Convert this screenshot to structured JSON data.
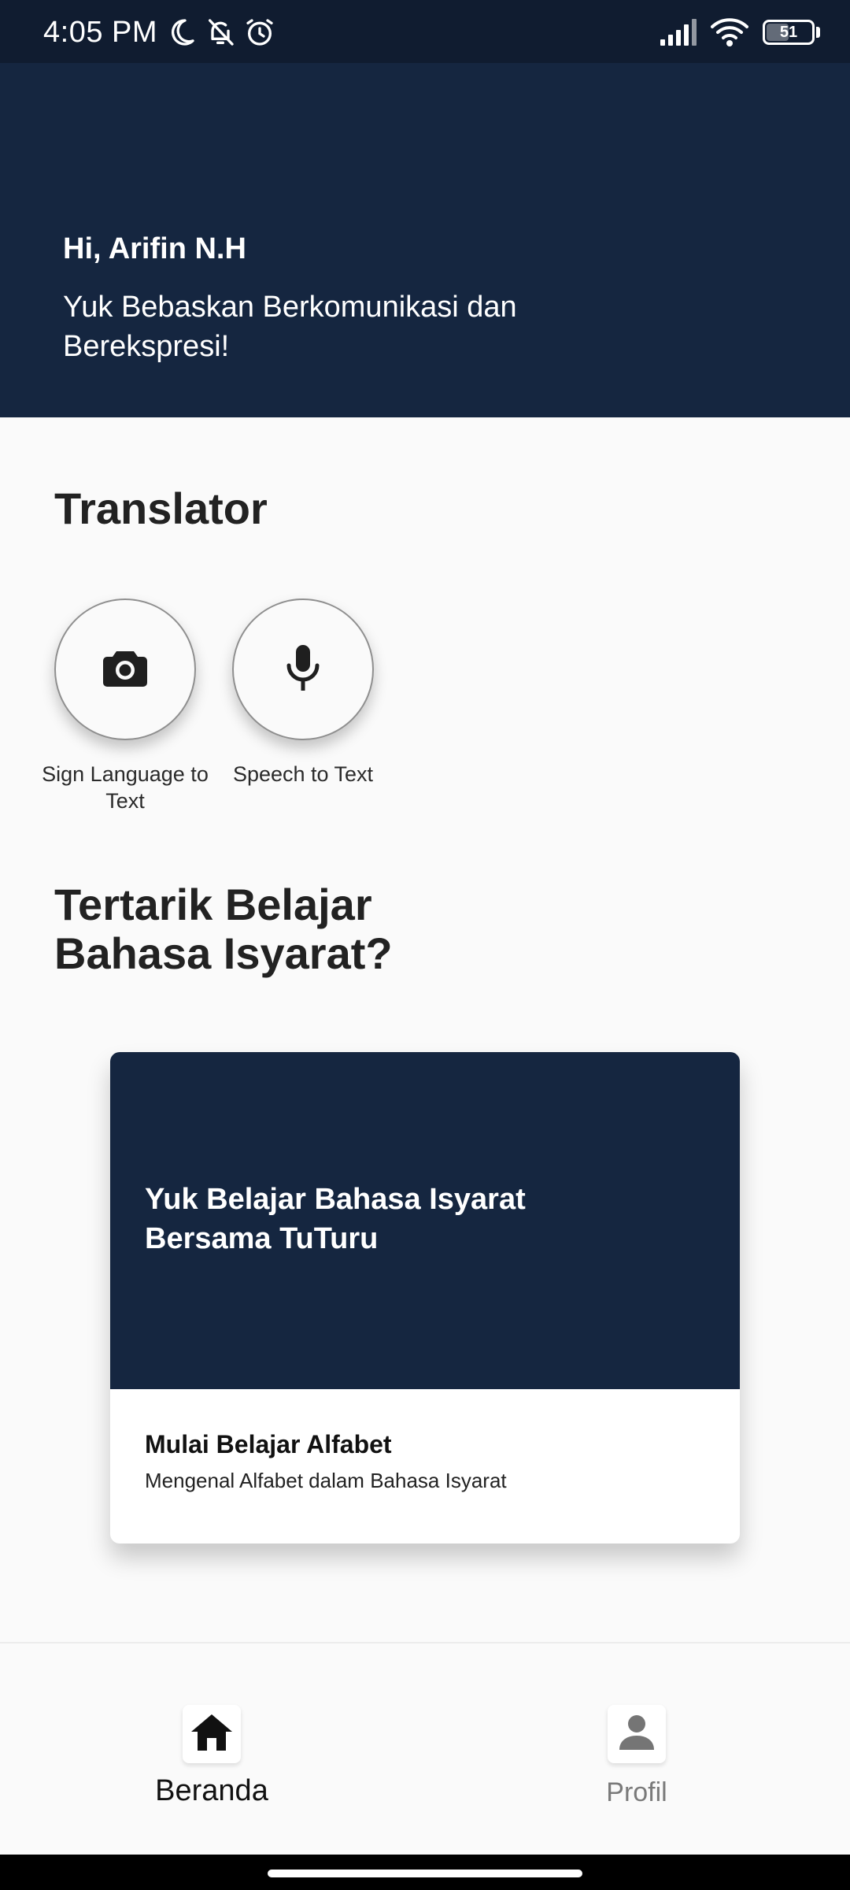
{
  "status_bar": {
    "time": "4:05 PM",
    "battery_level": "51",
    "icons": [
      "moon-icon",
      "bell-off-icon",
      "alarm-icon",
      "signal-icon",
      "wifi-icon",
      "battery-icon"
    ]
  },
  "header": {
    "greeting": "Hi, Arifin N.H",
    "tagline": "Yuk Bebaskan Berkomunikasi dan Berekspresi!"
  },
  "translator": {
    "title": "Translator",
    "buttons": [
      {
        "label": "Sign Language to Text",
        "icon": "camera-icon"
      },
      {
        "label": "Speech to Text",
        "icon": "microphone-icon"
      }
    ]
  },
  "learn": {
    "title": "Tertarik Belajar Bahasa Isyarat?",
    "card": {
      "banner_text": "Yuk Belajar Bahasa Isyarat Bersama TuTuru",
      "title": "Mulai Belajar Alfabet",
      "subtitle": "Mengenal Alfabet dalam Bahasa Isyarat"
    }
  },
  "bottom_nav": {
    "items": [
      {
        "label": "Beranda",
        "icon": "home-icon",
        "active": true
      },
      {
        "label": "Profil",
        "icon": "person-icon",
        "active": false
      }
    ]
  },
  "colors": {
    "header_bg": "#152640",
    "status_bg": "#101c30",
    "page_bg": "#fafafa"
  }
}
